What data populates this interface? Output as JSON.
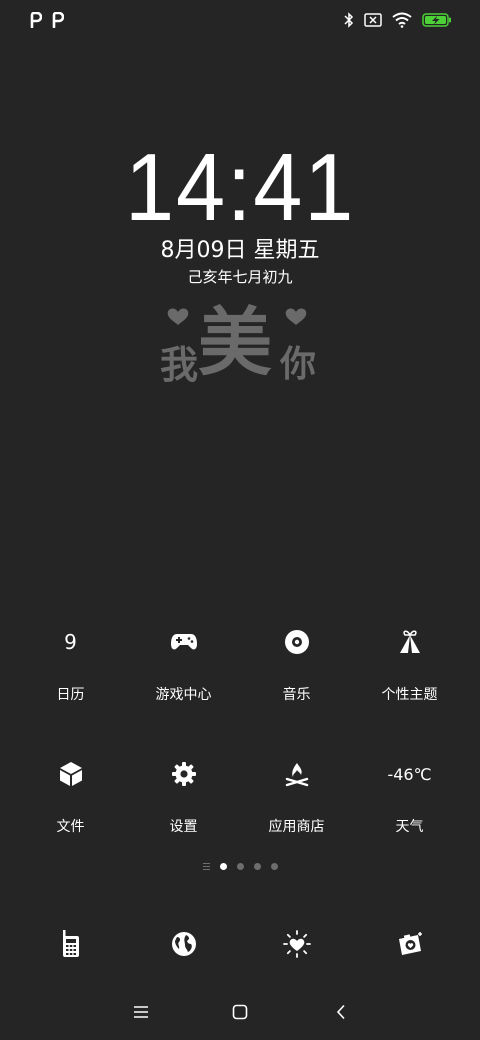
{
  "status_bar": {
    "left_icons": [
      "notification-p-icon",
      "notification-p-icon"
    ],
    "right_icons": [
      "bluetooth-icon",
      "no-sim-icon",
      "wifi-icon",
      "battery-charging-icon"
    ],
    "battery_color": "#4cd137"
  },
  "lockscreen": {
    "time": "14:41",
    "date": "8月09日 星期五",
    "lunar_date": "己亥年七月初九",
    "signature_text": "我美你"
  },
  "apps": {
    "row1": [
      {
        "label": "日历",
        "icon": "calendar-icon",
        "icon_text": "9"
      },
      {
        "label": "游戏中心",
        "icon": "gamepad-icon"
      },
      {
        "label": "音乐",
        "icon": "music-disc-icon"
      },
      {
        "label": "个性主题",
        "icon": "theme-gift-icon"
      }
    ],
    "row2": [
      {
        "label": "文件",
        "icon": "file-cube-icon"
      },
      {
        "label": "设置",
        "icon": "gear-icon"
      },
      {
        "label": "应用商店",
        "icon": "app-store-flame-icon"
      },
      {
        "label": "天气",
        "icon": "weather-icon",
        "icon_text": "-46℃"
      }
    ]
  },
  "page_indicator": {
    "pages": 4,
    "active_index": 0
  },
  "dock": [
    {
      "icon": "phone-icon"
    },
    {
      "icon": "browser-globe-icon"
    },
    {
      "icon": "heart-sun-icon"
    },
    {
      "icon": "camera-icon"
    }
  ],
  "nav_bar": {
    "buttons": [
      "menu-icon",
      "home-icon",
      "back-icon"
    ]
  },
  "colors": {
    "background": "#252525",
    "foreground": "#ffffff",
    "indicator_inactive": "#6e6e6e"
  }
}
